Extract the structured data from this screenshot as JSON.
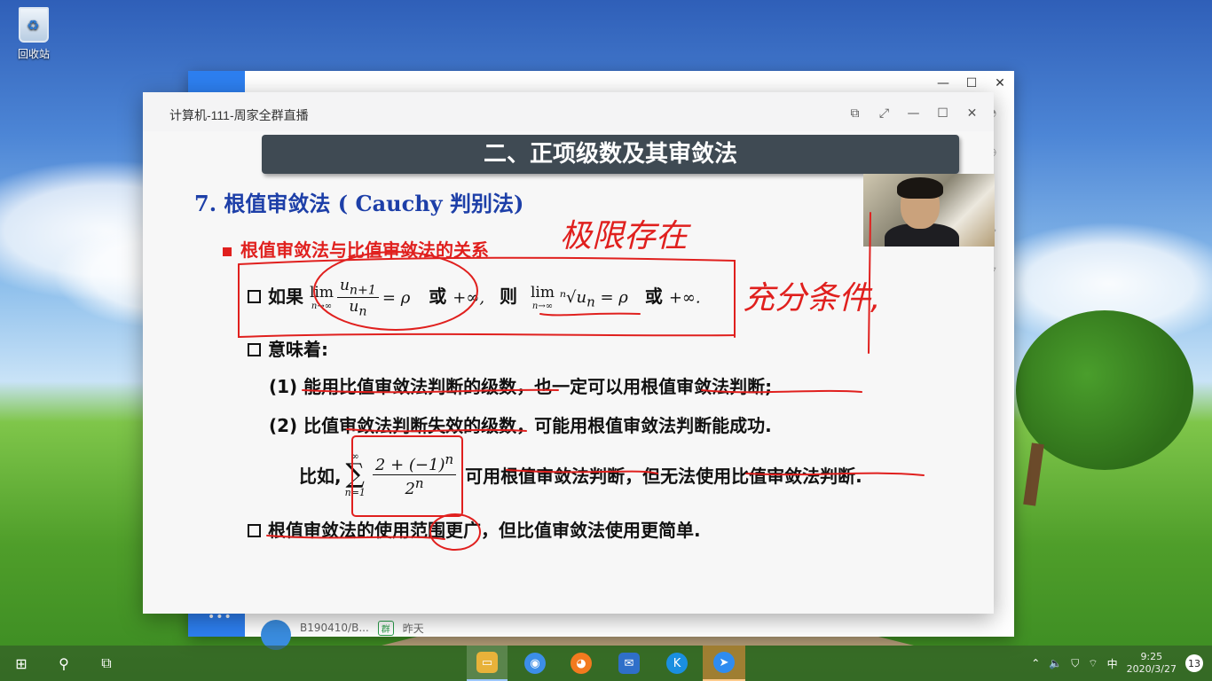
{
  "desktop": {
    "recycle_bin_label": "回收站"
  },
  "background_window": {
    "list_row_name": "B190410/B...",
    "list_row_time": "昨天",
    "list_row_tag": "群"
  },
  "live_window": {
    "title": "计算机-111-周家全群直播"
  },
  "slide": {
    "banner": "二、正项级数及其审敛法",
    "heading": "7. 根值审敛法 ( Cauchy 判别法)",
    "bullet_red": "根值审敛法与比值审敛法的关系",
    "if_label": "如果",
    "or_label": "或",
    "then_label": "则",
    "or_label2": "或",
    "means_label": "意味着:",
    "item1": "(1) 能用比值审敛法判断的级数，也一定可以用根值审敛法判断;",
    "item2": "(2) 比值审敛法判断失效的级数，可能用根值审敛法判断能成功.",
    "example_prefix": "比如,",
    "example_suffix": "可用根值审敛法判断，但无法使用比值审敛法判断.",
    "conclusion": "根值审敛法的使用范围更广，但比值审敛法使用更简单."
  },
  "handwriting": {
    "note_top": "极限存在",
    "note_right": "充分条件,"
  },
  "taskbar": {
    "clock_time": "9:25",
    "clock_date": "2020/3/27",
    "notification_count": "13"
  },
  "colors": {
    "heading_blue": "#1d3fa8",
    "accent_red": "#e0201e",
    "banner_bg": "#3f4a53"
  }
}
